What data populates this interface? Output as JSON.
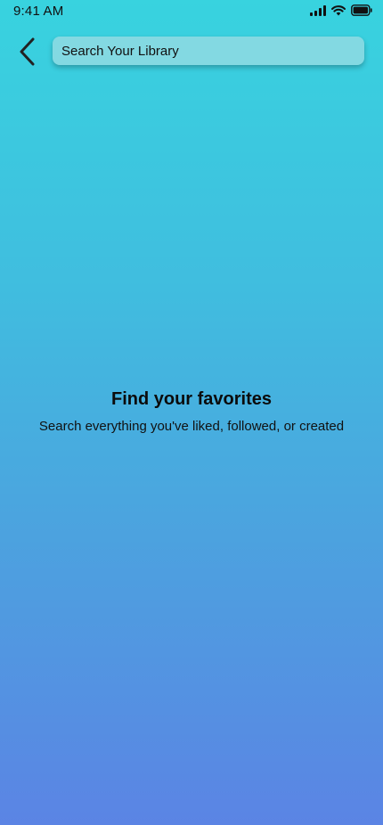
{
  "status_bar": {
    "time": "9:41 AM",
    "icons": [
      "signal-icon",
      "wifi-icon",
      "battery-icon"
    ]
  },
  "header": {
    "back_icon": "chevron-left-icon",
    "search": {
      "placeholder": "Search Your Library",
      "value": ""
    }
  },
  "empty_state": {
    "title": "Find your favorites",
    "subtitle": "Search everything you've liked, followed, or created"
  },
  "colors": {
    "gradient_top": "#38d3df",
    "gradient_bottom": "#5b84e4",
    "search_bg": "#83d9e2",
    "text": "#111111"
  }
}
